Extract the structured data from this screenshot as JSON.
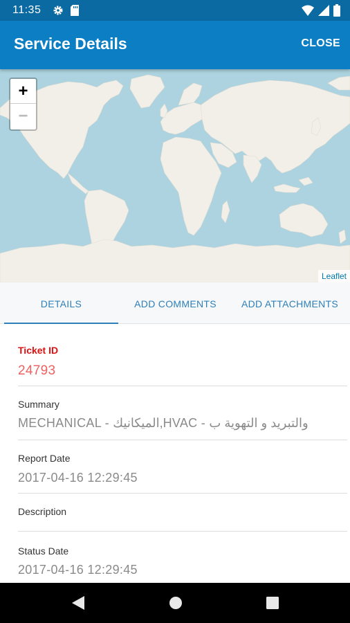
{
  "status_bar": {
    "time": "11:35",
    "icons_left": [
      "gear-icon",
      "sd-card-icon"
    ],
    "icons_right": [
      "wifi-icon",
      "signal-icon",
      "battery-icon"
    ]
  },
  "app_bar": {
    "title": "Service Details",
    "close_label": "CLOSE",
    "color": "#0c7fc4"
  },
  "map": {
    "zoom_in_label": "+",
    "zoom_out_label": "−",
    "attribution": "Leaflet",
    "water_color": "#acd3df",
    "land_color": "#f2efe9"
  },
  "tabs": [
    {
      "label": "DETAILS",
      "active": true
    },
    {
      "label": "ADD COMMENTS",
      "active": false
    },
    {
      "label": "ADD ATTACHMENTS",
      "active": false
    }
  ],
  "details": {
    "ticket_id": {
      "label": "Ticket ID",
      "value": "24793"
    },
    "summary": {
      "label": "Summary",
      "value": "MECHANICAL - الميكانيك,HVAC - والتبريد و التهوية ب"
    },
    "report_date": {
      "label": "Report Date",
      "value": "2017-04-16 12:29:45"
    },
    "description": {
      "label": "Description",
      "value": ""
    },
    "status_date": {
      "label": "Status Date",
      "value": "2017-04-16 12:29:45"
    }
  },
  "nav_bar": {
    "buttons": [
      "back-icon",
      "home-icon",
      "recents-icon"
    ]
  }
}
